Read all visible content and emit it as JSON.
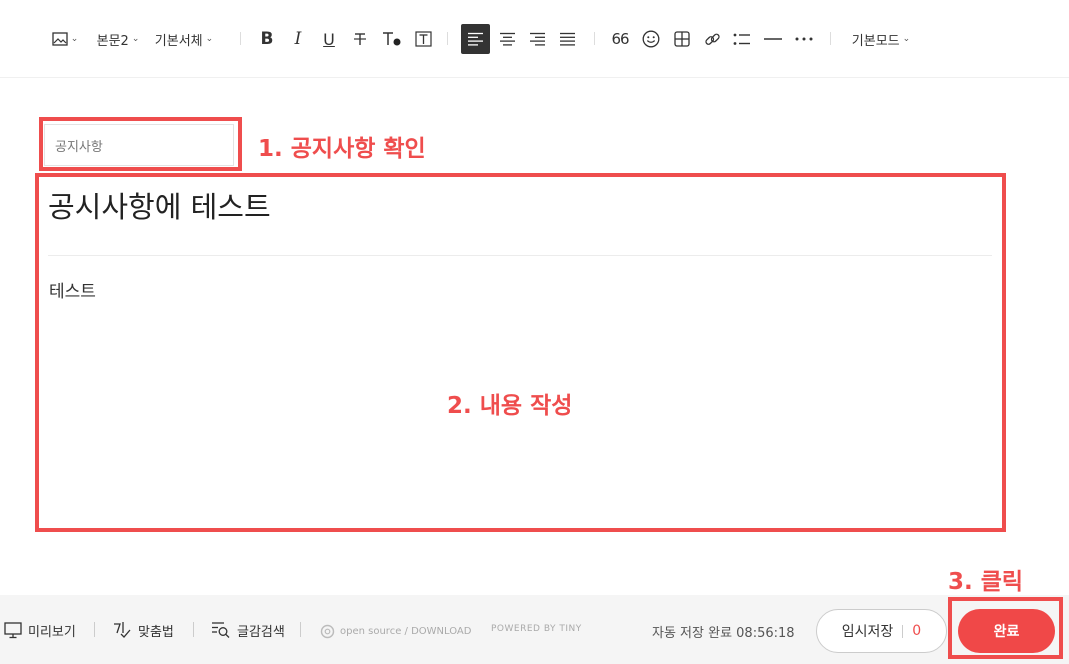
{
  "toolbar": {
    "image_icon": "image-icon",
    "paragraph_style": "본문2",
    "font_family": "기본서체",
    "quote_label": "66",
    "mode": "기본모드"
  },
  "editor": {
    "category_placeholder": "공지사항",
    "title": "공시사항에 테스트",
    "body": "테스트"
  },
  "annotations": {
    "step1": "1. 공지사항 확인",
    "step2": "2. 내용 작성",
    "step3": "3. 클릭"
  },
  "footer": {
    "preview": "미리보기",
    "spellcheck": "맞춤법",
    "search": "글감검색",
    "open_source": "open source / DOWNLOAD",
    "powered_by": "POWERED BY TINY",
    "autosave_status": "자동 저장 완료 08:56:18",
    "temp_save": "임시저장",
    "temp_save_count": "0",
    "done": "완료"
  },
  "colors": {
    "highlight": "#ef4d4d",
    "primary_button": "#f04848"
  }
}
